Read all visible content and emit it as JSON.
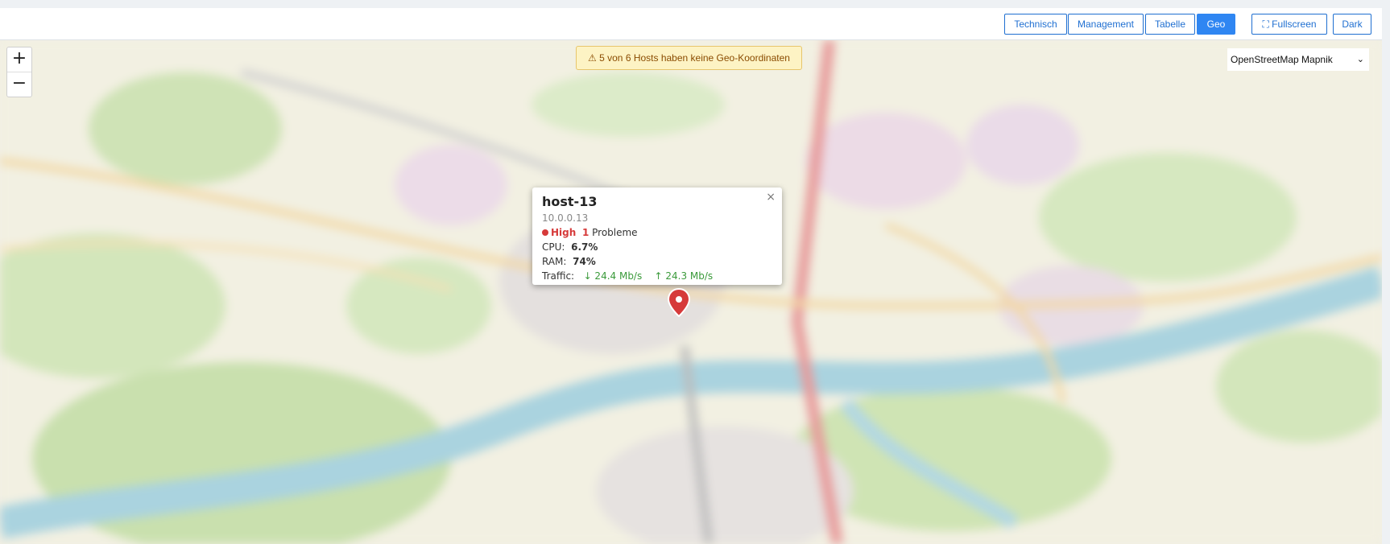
{
  "toolbar": {
    "buttons": [
      {
        "label": "Technisch",
        "active": false
      },
      {
        "label": "Management",
        "active": false
      },
      {
        "label": "Tabelle",
        "active": false
      },
      {
        "label": "Geo",
        "active": true
      },
      {
        "label": "⛶ Fullscreen",
        "active": false
      },
      {
        "label": "Dark",
        "active": false
      }
    ]
  },
  "map": {
    "zoom_in": "+",
    "zoom_out": "−",
    "warning": "⚠ 5 von 6 Hosts haben keine Geo-Koordinaten",
    "layer_select": "OpenStreetMap Mapnik",
    "layer_chevron": "⌄"
  },
  "popup": {
    "close": "×",
    "host": "host-13",
    "ip": "10.0.0.13",
    "severity": "High",
    "problem_count": "1",
    "problem_label": "Probleme",
    "cpu_label": "CPU:",
    "cpu_value": "6.7%",
    "ram_label": "RAM:",
    "ram_value": "74%",
    "traffic_label": "Traffic:",
    "traffic_down": "↓ 24.4 Mb/s",
    "traffic_up": "↑ 24.3 Mb/s"
  },
  "colors": {
    "accent": "#2f86f2",
    "severity_high": "#d63a3a",
    "traffic": "#3a9a3a",
    "warning_bg": "#fdf3c4"
  }
}
